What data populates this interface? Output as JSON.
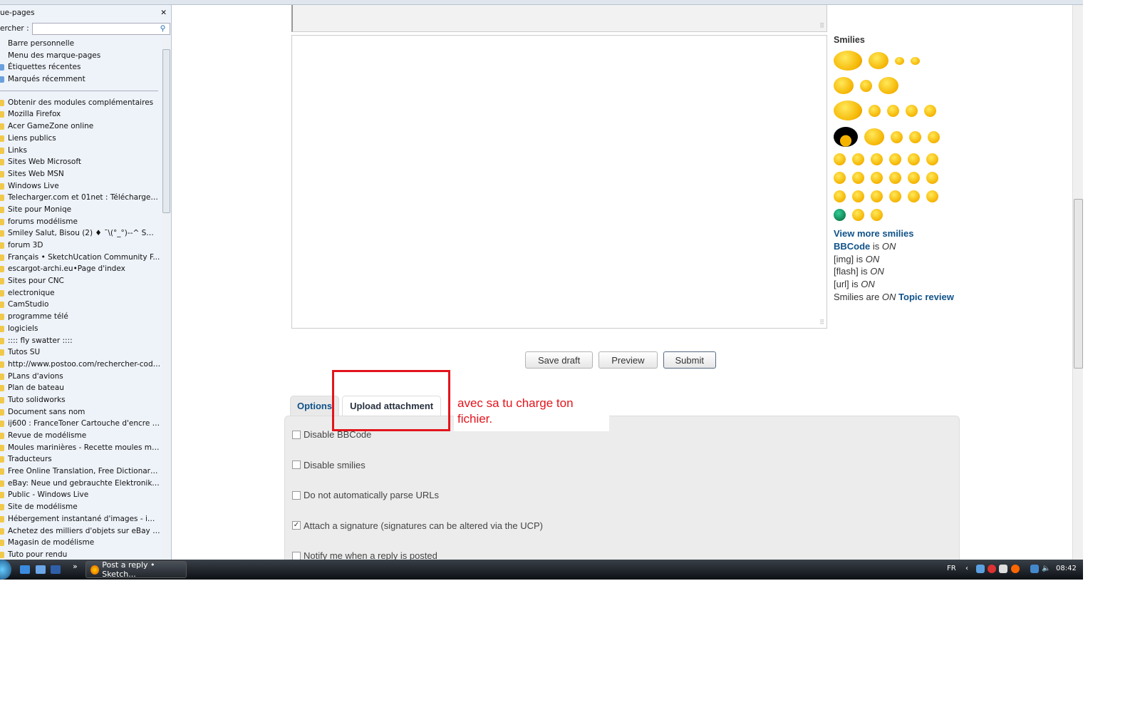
{
  "sidebar": {
    "title": "ue-pages",
    "search_label": "ercher :",
    "search_value": "",
    "top_items": [
      "Barre personnelle",
      "Menu des marque-pages",
      "Étiquettes récentes",
      "Marqués récemment"
    ],
    "items": [
      "Obtenir des modules complémentaires",
      "Mozilla Firefox",
      "Acer GameZone online",
      "Liens publics",
      "Links",
      "Sites Web Microsoft",
      "Sites Web MSN",
      "Windows Live",
      "Telecharger.com et 01net : Téléchargeme...",
      "Site  pour Moniqe",
      "forums modélisme",
      "Smiley Salut, Bisou (2) ♦ ˉ\\(°_°)--^ SmilCh...",
      "forum 3D",
      "Français • SketchUcation Community F...",
      "escargot-archi.eu•Page d'index",
      "Sites  pour CNC",
      "electronique",
      "CamStudio",
      "programme télé",
      "logiciels",
      ":::: fly swatter ::::",
      "Tutos SU",
      "http://www.postoo.com/rechercher-code...",
      "PLans d'avions",
      "Plan de bateau",
      "Tuto solidworks",
      "Document sans nom",
      "ij600 : FranceToner Cartouche d'encre po...",
      "Revue de modélisme",
      "Moules marinières - Recette moules mari...",
      "Traducteurs",
      "Free Online Translation, Free Dictionary – ...",
      "eBay: Neue und gebrauchte Elektronikarti...",
      "Public - Windows Live",
      "Site de modélisme",
      "Hébergement instantané d'images - imag...",
      "Achetez des milliers d'objets sur eBay - C...",
      "Magasin de modélisme",
      "Tuto pour rendu"
    ]
  },
  "smilies": {
    "title": "Smilies",
    "view_more": "View more smilies",
    "bbcode": "BBCode",
    "is": " is ",
    "on": "ON",
    "img": "[img] is ",
    "flash": "[flash] is ",
    "url": "[url] is ",
    "smilies_are": "Smilies are ",
    "topic_review": "Topic review"
  },
  "buttons": {
    "save_draft": "Save draft",
    "preview": "Preview",
    "submit": "Submit"
  },
  "tabs": [
    {
      "label": "Options"
    },
    {
      "label": "Upload attachment",
      "active": true
    }
  ],
  "options": [
    {
      "label": "Disable BBCode",
      "checked": false
    },
    {
      "label": "Disable smilies",
      "checked": false
    },
    {
      "label": "Do not automatically parse URLs",
      "checked": false
    },
    {
      "label": "Attach a signature (signatures can be altered via the UCP)",
      "checked": true
    },
    {
      "label": "Notify me when a reply is posted",
      "checked": false
    }
  ],
  "annotation": {
    "text": "avec sa tu charge ton fichier.",
    "color": "#e3141c"
  },
  "taskbar": {
    "task": "Post a reply • Sketch...",
    "lang": "FR",
    "time": "08:42",
    "chevrons": "»"
  }
}
